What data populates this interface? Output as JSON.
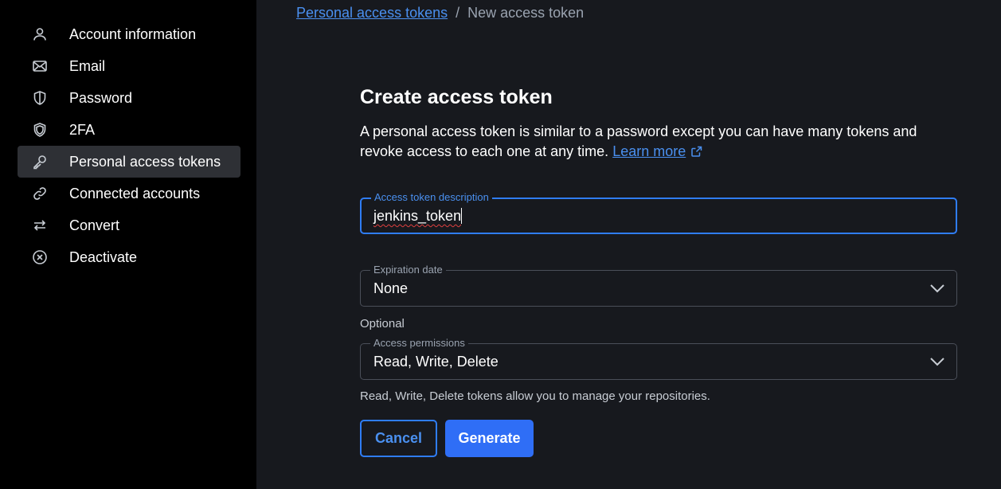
{
  "sidebar": {
    "items": [
      {
        "label": "Account information",
        "icon": "user-icon",
        "active": false
      },
      {
        "label": "Email",
        "icon": "envelope-icon",
        "active": false
      },
      {
        "label": "Password",
        "icon": "shield-icon",
        "active": false
      },
      {
        "label": "2FA",
        "icon": "shield-double-icon",
        "active": false
      },
      {
        "label": "Personal access tokens",
        "icon": "key-icon",
        "active": true
      },
      {
        "label": "Connected accounts",
        "icon": "link-icon",
        "active": false
      },
      {
        "label": "Convert",
        "icon": "swap-arrows-icon",
        "active": false
      },
      {
        "label": "Deactivate",
        "icon": "close-circle-icon",
        "active": false
      }
    ]
  },
  "breadcrumb": {
    "parent": "Personal access tokens",
    "separator": "/",
    "current": "New access token"
  },
  "form": {
    "title": "Create access token",
    "description": "A personal access token is similar to a password except you can have many tokens and revoke access to each one at any time.",
    "learn_more": "Learn more",
    "description_field": {
      "label": "Access token description",
      "value": "jenkins_token"
    },
    "expiration": {
      "label": "Expiration date",
      "value": "None"
    },
    "optional_label": "Optional",
    "permissions": {
      "label": "Access permissions",
      "value": "Read, Write, Delete"
    },
    "helper_text": "Read, Write, Delete tokens allow you to manage your repositories.",
    "cancel_label": "Cancel",
    "generate_label": "Generate"
  },
  "colors": {
    "accent": "#2f7df6",
    "link": "#4a90f0",
    "background": "#17191e",
    "sidebar": "#000000"
  }
}
